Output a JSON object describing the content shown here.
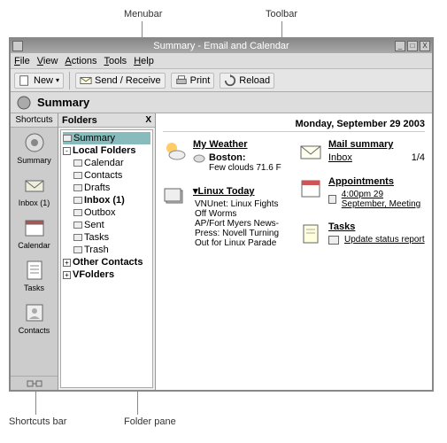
{
  "callouts": {
    "menubar": "Menubar",
    "toolbar": "Toolbar",
    "shortcuts_bar": "Shortcuts bar",
    "folder_pane": "Folder pane"
  },
  "window": {
    "title": "Summary - Email and Calendar",
    "min": "_",
    "max": "□",
    "close": "X"
  },
  "menubar": {
    "file": "File",
    "view": "View",
    "actions": "Actions",
    "tools": "Tools",
    "help": "Help"
  },
  "toolbar": {
    "new": "New",
    "send_receive": "Send / Receive",
    "print": "Print",
    "reload": "Reload"
  },
  "header": {
    "title": "Summary"
  },
  "shortcuts": {
    "header": "Shortcuts",
    "items": [
      {
        "label": "Summary"
      },
      {
        "label": "Inbox (1)"
      },
      {
        "label": "Calendar"
      },
      {
        "label": "Tasks"
      },
      {
        "label": "Contacts"
      }
    ]
  },
  "folderpane": {
    "header": "Folders",
    "close": "X",
    "tree": {
      "summary": "Summary",
      "local": "Local Folders",
      "calendar": "Calendar",
      "contacts": "Contacts",
      "drafts": "Drafts",
      "inbox": "Inbox (1)",
      "outbox": "Outbox",
      "sent": "Sent",
      "tasks": "Tasks",
      "trash": "Trash",
      "other": "Other Contacts",
      "vfolders": "VFolders"
    }
  },
  "main": {
    "date": "Monday, September 29 2003",
    "weather": {
      "title": "My Weather",
      "city": "Boston",
      "cond": "Few clouds 71.6 F"
    },
    "news": {
      "title": "Linux Today",
      "items": [
        "VNUnet: Linux Fights Off Worms",
        "AP/Fort Myers News-Press: Novell Turning Out for Linux Parade"
      ]
    },
    "mail": {
      "title": "Mail summary",
      "inbox_label": "Inbox",
      "inbox_count": "1/4"
    },
    "appts": {
      "title": "Appointments",
      "item": "4:00pm 29 September, Meeting"
    },
    "tasks": {
      "title": "Tasks",
      "item": "Update status report"
    }
  }
}
